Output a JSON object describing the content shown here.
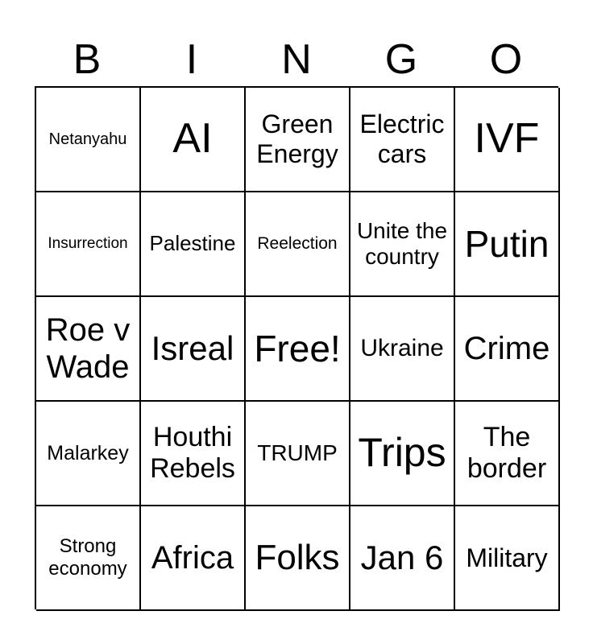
{
  "header": [
    "B",
    "I",
    "N",
    "G",
    "O"
  ],
  "cells": [
    {
      "text": "Netanyahu",
      "size": 20
    },
    {
      "text": "AI",
      "size": 52
    },
    {
      "text": "Green Energy",
      "size": 32
    },
    {
      "text": "Electric cars",
      "size": 32
    },
    {
      "text": "IVF",
      "size": 52
    },
    {
      "text": "Insurrection",
      "size": 19
    },
    {
      "text": "Palestine",
      "size": 26
    },
    {
      "text": "Reelection",
      "size": 21
    },
    {
      "text": "Unite the country",
      "size": 28
    },
    {
      "text": "Putin",
      "size": 46
    },
    {
      "text": "Roe v Wade",
      "size": 40
    },
    {
      "text": "Isreal",
      "size": 42
    },
    {
      "text": "Free!",
      "size": 46
    },
    {
      "text": "Ukraine",
      "size": 30
    },
    {
      "text": "Crime",
      "size": 40
    },
    {
      "text": "Malarkey",
      "size": 25
    },
    {
      "text": "Houthi Rebels",
      "size": 34
    },
    {
      "text": "TRUMP",
      "size": 28
    },
    {
      "text": "Trips",
      "size": 50
    },
    {
      "text": "The border",
      "size": 34
    },
    {
      "text": "Strong economy",
      "size": 24
    },
    {
      "text": "Africa",
      "size": 40
    },
    {
      "text": "Folks",
      "size": 44
    },
    {
      "text": "Jan 6",
      "size": 42
    },
    {
      "text": "Military",
      "size": 32
    }
  ]
}
